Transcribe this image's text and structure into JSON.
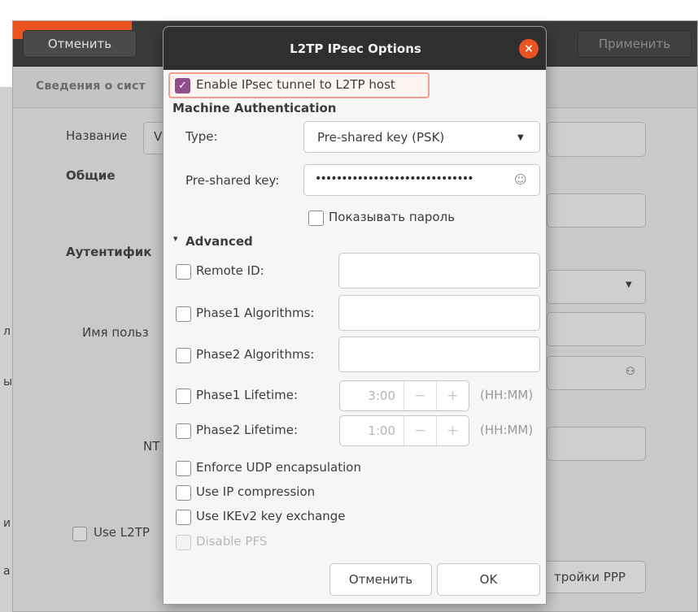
{
  "parent": {
    "header": {
      "cancel": "Отменить",
      "apply": "Применить"
    },
    "tab": "Сведения о сист",
    "name_label": "Название",
    "name_value_partial": "V",
    "general_heading": "Общие",
    "auth_heading": "Аутентифик",
    "username_label": "Имя польз",
    "nt_label": "NT",
    "use_l2tp": "Use L2TP",
    "ppp_button": "тройки PPP",
    "left_edge_letters": [
      "л",
      "ы",
      "и",
      "а"
    ]
  },
  "dialog": {
    "title": "L2TP IPsec Options",
    "enable_ipsec": {
      "label": "Enable IPsec tunnel to L2TP host",
      "checked": true
    },
    "machine_auth_heading": "Machine Authentication",
    "type": {
      "label": "Type:",
      "value": "Pre-shared key (PSK)"
    },
    "psk": {
      "label": "Pre-shared key:",
      "value": "••••••••••••••••••••••••••••••"
    },
    "show_password": {
      "label": "Показывать пароль",
      "checked": false
    },
    "advanced": {
      "label": "Advanced",
      "expanded": true
    },
    "remote_id": {
      "label": "Remote ID:",
      "value": ""
    },
    "phase1_algorithms": {
      "label": "Phase1 Algorithms:",
      "value": ""
    },
    "phase2_algorithms": {
      "label": "Phase2 Algorithms:",
      "value": ""
    },
    "phase1_lifetime": {
      "label": "Phase1 Lifetime:",
      "value": "3:00",
      "unit": "(HH:MM)"
    },
    "phase2_lifetime": {
      "label": "Phase2 Lifetime:",
      "value": "1:00",
      "unit": "(HH:MM)"
    },
    "enforce_udp": "Enforce UDP encapsulation",
    "ip_compression": "Use IP compression",
    "ikev2": "Use IKEv2 key exchange",
    "disable_pfs": "Disable PFS",
    "cancel": "Отменить",
    "ok": "OK"
  },
  "icons": {
    "close": "×",
    "dropdown": "▼",
    "expander": "▾",
    "minus": "−",
    "plus": "+",
    "checkmark": "✓",
    "psk_icon": "person-icon",
    "key_icon": "user-key-icon"
  },
  "colors": {
    "accent": "#e95420",
    "checkbox": "#924d8b",
    "highlight": "#f0a08a"
  }
}
